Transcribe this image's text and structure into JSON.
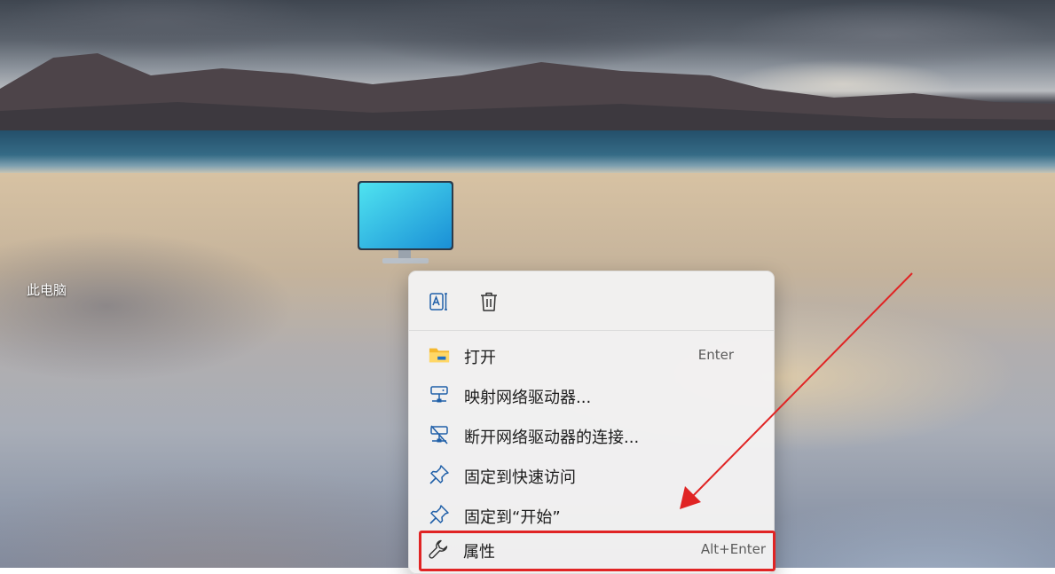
{
  "desktop": {
    "icon_label": "此电脑",
    "wallpaper": "beach-landscape"
  },
  "context_menu": {
    "quick_actions": [
      {
        "name": "rename",
        "icon": "rename-icon"
      },
      {
        "name": "delete",
        "icon": "trash-icon"
      }
    ],
    "items": [
      {
        "label": "打开",
        "shortcut": "Enter",
        "icon": "folder-icon"
      },
      {
        "label": "映射网络驱动器...",
        "shortcut": "",
        "icon": "network-drive-icon"
      },
      {
        "label": "断开网络驱动器的连接...",
        "shortcut": "",
        "icon": "disconnect-network-drive-icon"
      },
      {
        "label": "固定到快速访问",
        "shortcut": "",
        "icon": "pin-icon"
      },
      {
        "label": "固定到“开始”",
        "shortcut": "",
        "icon": "pin-icon"
      },
      {
        "label": "属性",
        "shortcut": "Alt+Enter",
        "icon": "wrench-icon"
      }
    ]
  },
  "colors": {
    "highlight_box": "#e02424",
    "arrow": "#e02424",
    "folder": "#f5b82e",
    "icon_blue": "#1f5fa8"
  }
}
